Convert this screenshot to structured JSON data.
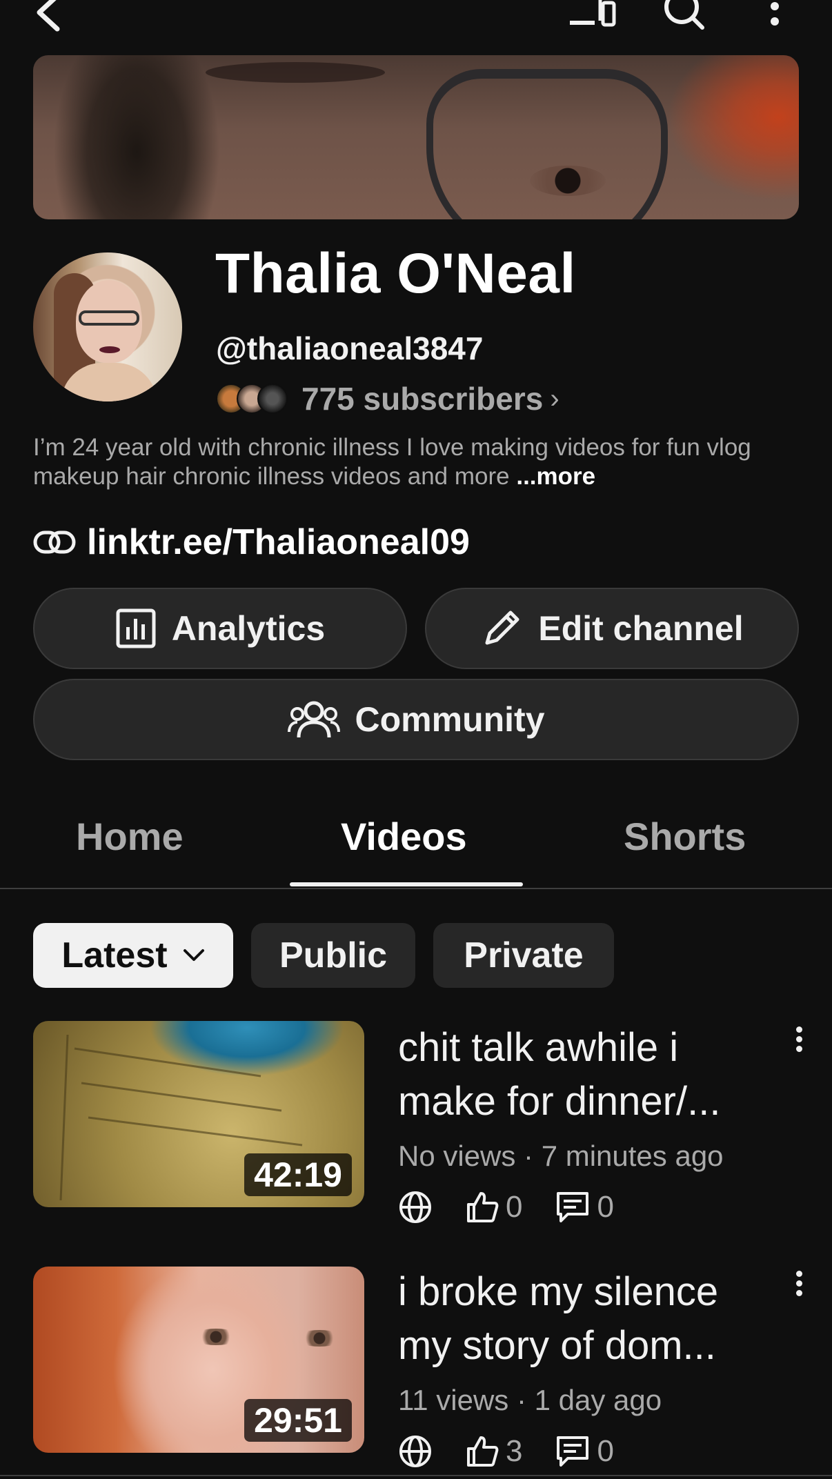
{
  "topbar": {
    "back_icon": "arrow-back-icon",
    "cast_icon": "cast-icon",
    "search_icon": "search-icon",
    "more_icon": "more-vertical-icon"
  },
  "channel": {
    "name": "Thalia O'Neal",
    "handle": "@thaliaoneal3847",
    "subscribers": "775 subscribers",
    "description": "I’m 24 year old with chronic illness I love making videos for fun vlog makeup hair chronic illness videos and more",
    "more_label": "...more",
    "link": "linktr.ee/Thaliaoneal09"
  },
  "actions": {
    "analytics": "Analytics",
    "edit_channel": "Edit channel",
    "community": "Community"
  },
  "tabs": [
    {
      "label": "Home",
      "active": false
    },
    {
      "label": "Videos",
      "active": true
    },
    {
      "label": "Shorts",
      "active": false
    }
  ],
  "filters": {
    "sort": "Latest",
    "chips": [
      "Public",
      "Private"
    ]
  },
  "videos": [
    {
      "title_line1": "chit talk awhile i",
      "title_line2": "make for dinner/...",
      "meta": "No views · 7 minutes ago",
      "duration": "42:19",
      "likes": "0",
      "comments": "0"
    },
    {
      "title_line1": "i broke my silence",
      "title_line2": "my story of dom...",
      "meta": "11 views · 1 day ago",
      "duration": "29:51",
      "likes": "3",
      "comments": "0"
    }
  ],
  "colors": {
    "background": "#0f0f0f",
    "button": "#272727",
    "text_primary": "#f1f1f1",
    "text_secondary": "#aaaaaa"
  }
}
